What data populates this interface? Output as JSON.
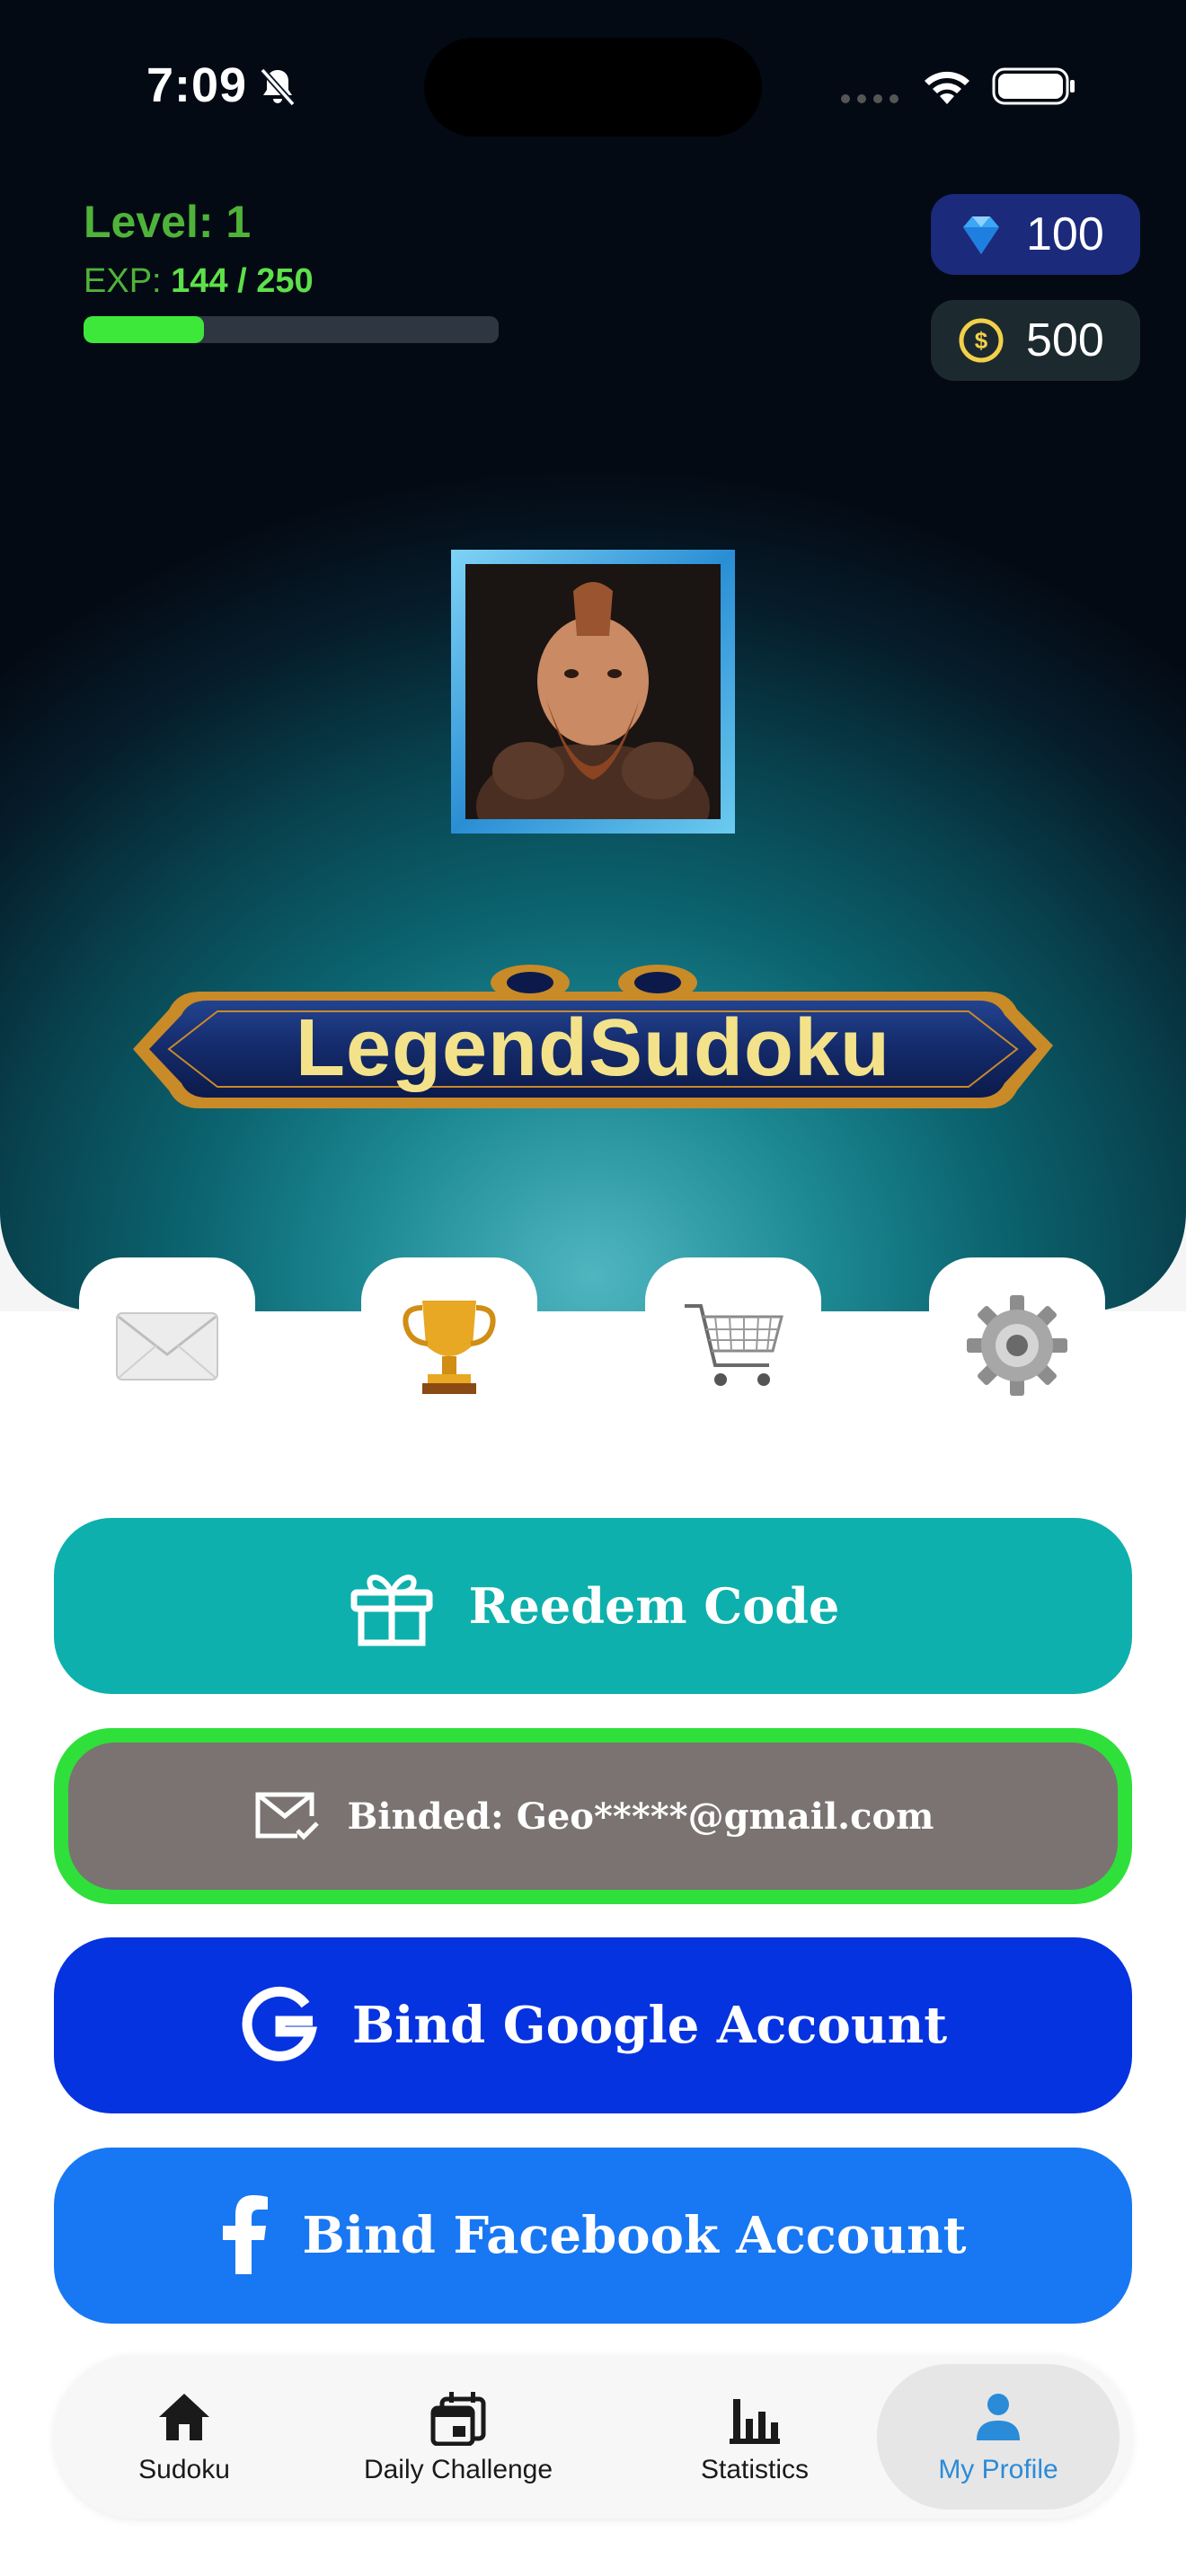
{
  "status_bar": {
    "time": "7:09"
  },
  "player": {
    "level_label": "Level: 1",
    "exp_prefix": "EXP:",
    "exp_value": "144 / 250",
    "exp_progress": 0.29
  },
  "currencies": {
    "gems": "100",
    "coins": "500"
  },
  "banner": {
    "title": "LegendSudoku"
  },
  "shortcuts": [
    {
      "name": "mail",
      "icon": "envelope-icon"
    },
    {
      "name": "achievements",
      "icon": "trophy-icon"
    },
    {
      "name": "shop",
      "icon": "shopping-cart-icon"
    },
    {
      "name": "settings",
      "icon": "gear-icon"
    }
  ],
  "actions": {
    "redeem_label": "Reedem Code",
    "bound_email_label": "Binded: Geo*****@gmail.com",
    "google_label": "Bind Google Account",
    "facebook_label": "Bind Facebook Account"
  },
  "nav": {
    "items": [
      {
        "label": "Sudoku",
        "icon": "home-icon"
      },
      {
        "label": "Daily Challenge",
        "icon": "calendar-icon"
      },
      {
        "label": "Statistics",
        "icon": "bar-chart-icon"
      },
      {
        "label": "My Profile",
        "icon": "person-icon"
      }
    ],
    "active_index": 3
  },
  "colors": {
    "exp_fill": "#3ee83a",
    "redeem": "#0db0ac",
    "bound_border": "#2fe03a",
    "google": "#0633e0",
    "facebook": "#1877f2",
    "nav_active": "#2a8bd8"
  }
}
